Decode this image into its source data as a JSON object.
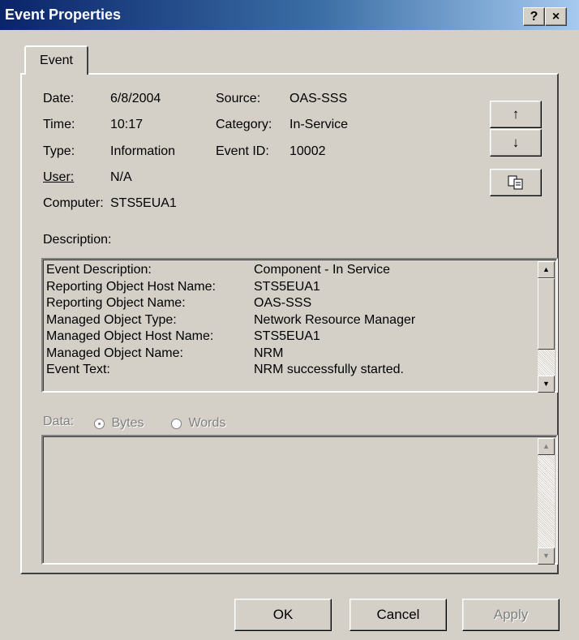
{
  "window": {
    "title": "Event Properties",
    "help_label": "?",
    "close_label": "×"
  },
  "tab": {
    "label": "Event"
  },
  "fields": {
    "date_label": "Date:",
    "date_value": "6/8/2004",
    "time_label": "Time:",
    "time_value": "10:17",
    "type_label": "Type:",
    "type_value": "Information",
    "user_label": "User:",
    "user_value": "N/A",
    "computer_label": "Computer:",
    "computer_value": "STS5EUA1",
    "source_label": "Source:",
    "source_value": "OAS-SSS",
    "category_label": "Category:",
    "category_value": "In-Service",
    "eventid_label": "Event ID:",
    "eventid_value": "10002"
  },
  "side_buttons": {
    "up_icon": "↑",
    "down_icon": "↓",
    "copy_icon": "copy-icon"
  },
  "description": {
    "label": "Description:",
    "rows": [
      {
        "key": "Event Description:",
        "value": "Component - In Service"
      },
      {
        "key": "Reporting Object Host Name:",
        "value": "STS5EUA1"
      },
      {
        "key": "Reporting Object Name:",
        "value": "OAS-SSS"
      },
      {
        "key": "Managed Object Type:",
        "value": "Network Resource Manager"
      },
      {
        "key": "Managed Object Host Name:",
        "value": "STS5EUA1"
      },
      {
        "key": "Managed Object Name:",
        "value": "NRM"
      },
      {
        "key": "Event Text:",
        "value": "NRM successfully started."
      }
    ]
  },
  "data_section": {
    "label": "Data:",
    "bytes_label": "Bytes",
    "words_label": "Words",
    "selected": "Bytes"
  },
  "footer": {
    "ok_label": "OK",
    "cancel_label": "Cancel",
    "apply_label": "Apply"
  },
  "colors": {
    "title_start": "#0a246a",
    "title_end": "#a6caf0",
    "face": "#d4d0c8",
    "disabled_text": "#808080"
  }
}
